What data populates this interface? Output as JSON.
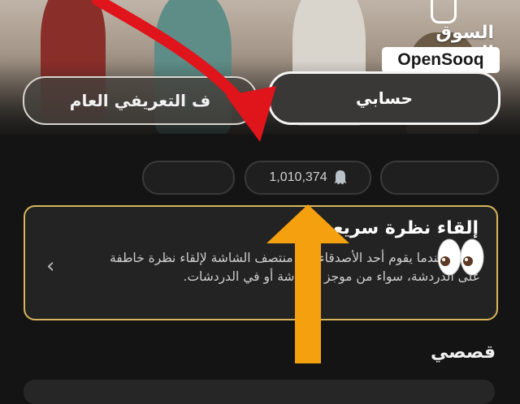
{
  "logo": {
    "arabic": "السوق المفتوح",
    "latin": "OpenSooq"
  },
  "tabs": {
    "public_profile": "ف التعريفي العام",
    "my_account": "حسابي"
  },
  "stats": {
    "views": "1,010,374"
  },
  "card": {
    "title": "إلقاء نظرة سريعة",
    "body": "اعرف عندما يقوم أحد الأصدقاء إلى منتصف الشاشة لإلقاء نظرة خاطفة على الدردشة، سواء من موجز الدردشة أو في الدردشات."
  },
  "section": {
    "title": "قصصي"
  },
  "colors": {
    "card_border": "#d7b65a",
    "arrow_red": "#e0141b",
    "arrow_orange": "#f5a10f",
    "background": "#141414"
  },
  "icons": [
    "ghost-icon",
    "chevron-left-icon",
    "eyes-emoji-icon"
  ]
}
